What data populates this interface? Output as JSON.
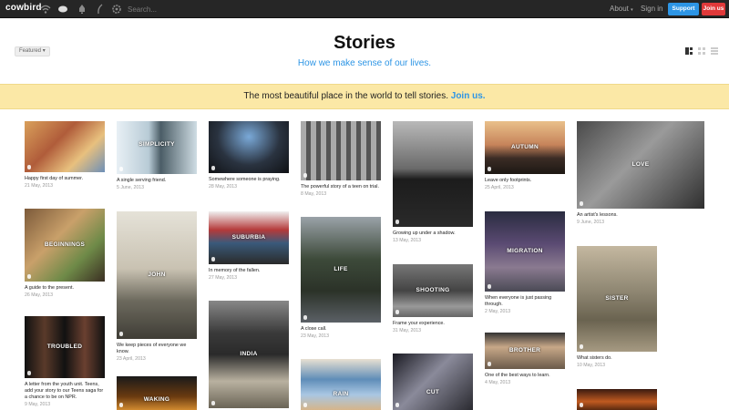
{
  "nav": {
    "logo": "cowbird",
    "icons": [
      "wifi-icon",
      "chat-bubble-icon",
      "bell-icon",
      "feather-icon",
      "settings-icon"
    ],
    "search_placeholder": "Search...",
    "about": "About",
    "sign_in": "Sign in",
    "support_label": "Support us",
    "join_label": "Join us"
  },
  "header": {
    "featured": "Featured",
    "title": "Stories",
    "subtitle": "How we make sense of our lives."
  },
  "banner": {
    "text": "The most beautiful place in the world to tell stories.",
    "link": "Join us."
  },
  "colors": {
    "accent_blue": "#2d95e5",
    "join_red": "#e0393a",
    "banner_yellow": "#fbe8a6",
    "nav_dark": "#262626"
  },
  "stories": [
    {
      "label": "",
      "caption": "Happy first day of summer.",
      "date": "21 May, 2013"
    },
    {
      "label": "SIMPLICITY",
      "caption": "A single serving friend.",
      "date": "5 June, 2013"
    },
    {
      "label": "",
      "caption": "Somewhere someone is praying.",
      "date": "28 May, 2013"
    },
    {
      "label": "",
      "caption": "The powerful story of a teen on trial.",
      "date": "8 May, 2013"
    },
    {
      "label": "",
      "caption": "Growing up under a shadow.",
      "date": "13 May, 2013"
    },
    {
      "label": "AUTUMN",
      "caption": "Leave only footprints.",
      "date": "25 April, 2013"
    },
    {
      "label": "LOVE",
      "caption": "An artist's lessons.",
      "date": "9 June, 2013"
    },
    {
      "label": "BEGINNINGS",
      "caption": "A guide to the present.",
      "date": "26 May, 2013"
    },
    {
      "label": "JOHN",
      "caption": "We keep pieces of everyone we know.",
      "date": "23 April, 2013"
    },
    {
      "label": "SUBURBIA",
      "caption": "In memory of the fallen.",
      "date": "27 May, 2013"
    },
    {
      "label": "LIFE",
      "caption": "A close call.",
      "date": "23 May, 2013"
    },
    {
      "label": "SHOOTING",
      "caption": "Frame your experience.",
      "date": "31 May, 2013"
    },
    {
      "label": "MIGRATION",
      "caption": "When everyone is just passing through.",
      "date": "2 May, 2013"
    },
    {
      "label": "SISTER",
      "caption": "What sisters do.",
      "date": "10 May, 2013"
    },
    {
      "label": "TROUBLED",
      "caption": "A letter from the youth unit. Teens, add your story to our Teens saga for a chance to be on NPR.",
      "date": "9 May, 2013"
    },
    {
      "label": "INDIA",
      "caption": "",
      "date": ""
    },
    {
      "label": "BROTHER",
      "caption": "One of the best ways to learn.",
      "date": "4 May, 2013"
    },
    {
      "label": "WAKING",
      "caption": "",
      "date": ""
    },
    {
      "label": "RAIN",
      "caption": "",
      "date": ""
    },
    {
      "label": "CUT",
      "caption": "",
      "date": ""
    },
    {
      "label": "",
      "caption": "",
      "date": ""
    }
  ]
}
